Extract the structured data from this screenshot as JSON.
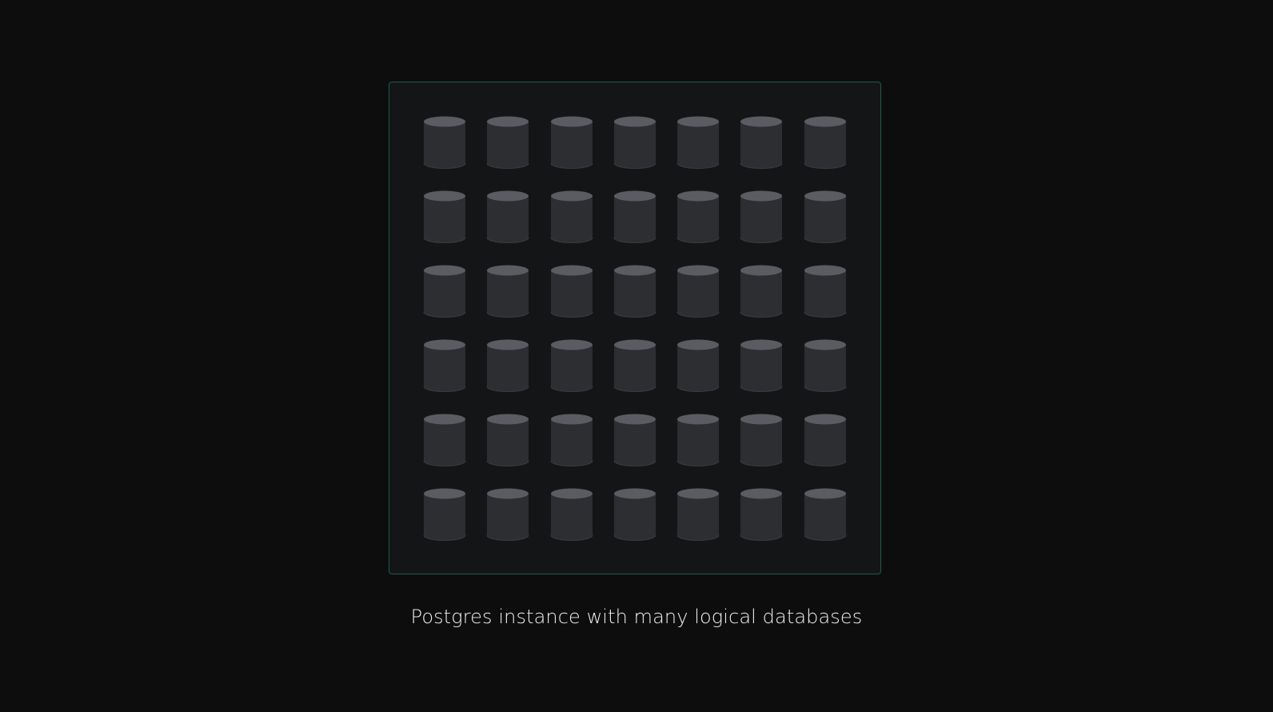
{
  "diagram": {
    "caption": "Postgres instance with many logical databases",
    "grid": {
      "rows": 6,
      "columns": 7
    },
    "icon": "database-cylinder-icon",
    "colors": {
      "background": "#0d0d0d",
      "box_fill": "#131517",
      "box_border": "#1f5c45",
      "cylinder_body": "#2c2e32",
      "cylinder_top": "#5a5c62",
      "caption_text": "#ededed"
    }
  }
}
